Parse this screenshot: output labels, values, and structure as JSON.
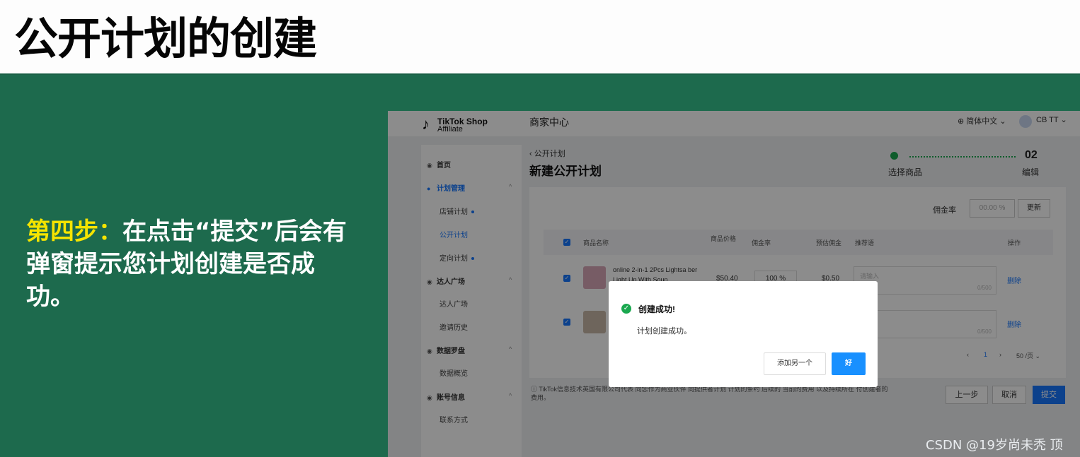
{
  "slide": {
    "title": "公开计划的创建",
    "step_highlight": "第四步：",
    "step_text": "在点击“提交”后会有弹窗提示您计划创建是否成功。"
  },
  "app": {
    "logo_line1": "TikTok Shop",
    "logo_line2": "Affiliate",
    "center_title": "商家中心",
    "language": "简体中文",
    "user": "CB TT"
  },
  "sidebar": {
    "items": [
      {
        "label": "首页"
      },
      {
        "label": "计划管理"
      },
      {
        "label": "店铺计划"
      },
      {
        "label": "公开计划"
      },
      {
        "label": "定向计划"
      },
      {
        "label": "达人广场"
      },
      {
        "label": "达人广场"
      },
      {
        "label": "邀请历史"
      },
      {
        "label": "数据罗盘"
      },
      {
        "label": "数据概览"
      },
      {
        "label": "账号信息"
      },
      {
        "label": "联系方式"
      }
    ]
  },
  "page": {
    "back": "公开计划",
    "title": "新建公开计划",
    "step_number": "02",
    "step1_label": "选择商品",
    "step2_label": "编辑"
  },
  "toolbar": {
    "rate_label": "佣金率",
    "rate_placeholder": "00.00 %",
    "update_label": "更新"
  },
  "table": {
    "columns": [
      "商品名称",
      "商品价格",
      "佣金率",
      "预估佣金",
      "推荐语",
      "操作"
    ],
    "rows": [
      {
        "name": "online 2-in-1 2Pcs Lightsa ber Light Up With Soun",
        "price": "$50.40",
        "rate": "100 %",
        "commission": "$0.50",
        "placeholder": "请输入",
        "count": "0/500",
        "action": "删除"
      },
      {
        "name": "",
        "price": "",
        "rate": "",
        "commission": "",
        "placeholder": "",
        "count": "0/500",
        "action": "删除"
      }
    ]
  },
  "pagination": {
    "page": "1",
    "page_size": "50 /页"
  },
  "footer": {
    "note": "TikTok信息技术英国有限公司代表 向您作为商业伙伴 向提供者计划 计划的条约 后续的 当前的费用 以及持续所在 付创建者的费用。",
    "prev": "上一步",
    "cancel": "取消",
    "submit": "提交"
  },
  "modal": {
    "title": "创建成功!",
    "message": "计划创建成功。",
    "add_another": "添加另一个",
    "ok": "好"
  },
  "watermark": "CSDN @19岁尚未秃 顶"
}
